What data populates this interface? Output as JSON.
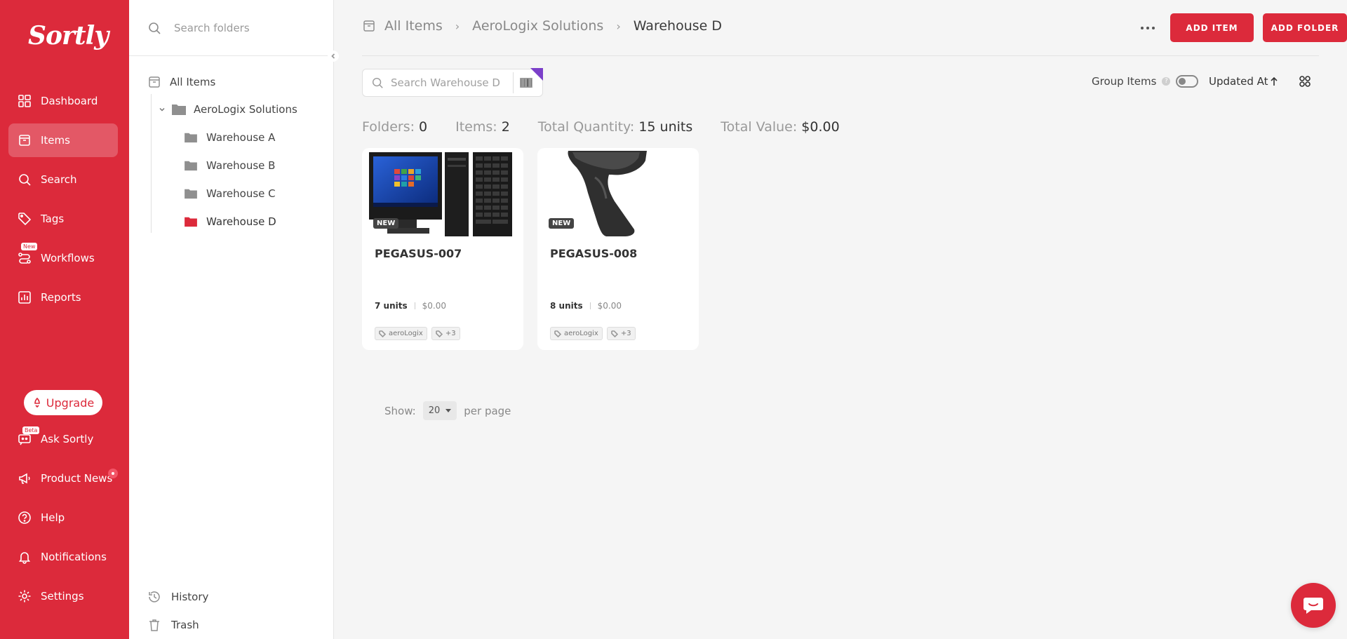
{
  "brand": {
    "logo": "Sortly",
    "accent": "#dc2a3b",
    "badge_color": "#7b3fc9"
  },
  "nav": {
    "items": [
      {
        "label": "Dashboard",
        "icon": "dashboard-icon"
      },
      {
        "label": "Items",
        "icon": "items-icon",
        "active": true
      },
      {
        "label": "Search",
        "icon": "search-icon"
      },
      {
        "label": "Tags",
        "icon": "tag-icon"
      },
      {
        "label": "Workflows",
        "icon": "workflows-icon",
        "badge": "New"
      },
      {
        "label": "Reports",
        "icon": "reports-icon"
      }
    ],
    "upgrade_label": "Upgrade",
    "bottom_items": [
      {
        "label": "Ask Sortly",
        "icon": "chat-bot-icon",
        "badge": "Beta"
      },
      {
        "label": "Product News",
        "icon": "megaphone-icon"
      },
      {
        "label": "Help",
        "icon": "help-icon"
      },
      {
        "label": "Notifications",
        "icon": "bell-icon"
      },
      {
        "label": "Settings",
        "icon": "gear-icon"
      }
    ]
  },
  "folders": {
    "search_placeholder": "Search folders",
    "all_items": "All Items",
    "root": "AeroLogix Solutions",
    "children": [
      "Warehouse A",
      "Warehouse B",
      "Warehouse C",
      "Warehouse D"
    ],
    "active": "Warehouse D",
    "history": "History",
    "trash": "Trash"
  },
  "header": {
    "breadcrumb": [
      "All Items",
      "AeroLogix Solutions",
      "Warehouse D"
    ],
    "add_item": "ADD ITEM",
    "add_folder": "ADD FOLDER"
  },
  "toolbar": {
    "search_placeholder": "Search Warehouse D",
    "group_items": "Group Items",
    "help_mark": "?",
    "sort_label": "Updated At"
  },
  "summary": {
    "folders_label": "Folders:",
    "folders_value": "0",
    "items_label": "Items:",
    "items_value": "2",
    "qty_label": "Total Quantity:",
    "qty_value": "15 units",
    "value_label": "Total Value:",
    "value_value": "$0.00"
  },
  "items": [
    {
      "name": "PEGASUS-007",
      "badge": "NEW",
      "units": "7 units",
      "value": "$0.00",
      "tags": [
        "aeroLogix",
        "+3"
      ],
      "image": "desktop-computer-image"
    },
    {
      "name": "PEGASUS-008",
      "badge": "NEW",
      "units": "8 units",
      "value": "$0.00",
      "tags": [
        "aeroLogix",
        "+3"
      ],
      "image": "barcode-scanner-image"
    }
  ],
  "pager": {
    "show": "Show:",
    "per_page_value": "20",
    "per_page": "per page"
  }
}
